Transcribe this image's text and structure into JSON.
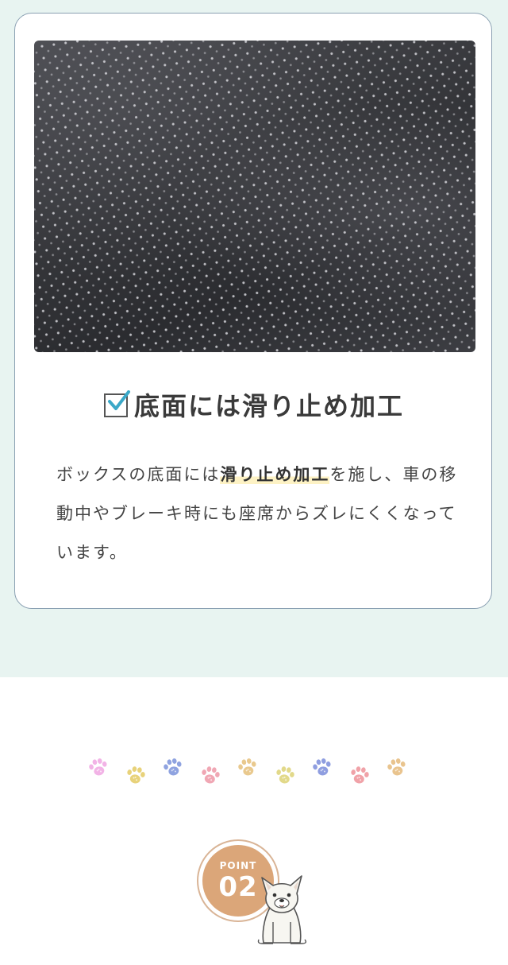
{
  "feature": {
    "heading": "底面には滑り止め加工",
    "body_before": "ボックスの底面には",
    "body_highlight": "滑り止め加工",
    "body_after": "を施し、車の移動中やブレーキ時にも座席からズレにくくなっています。"
  },
  "paws": {
    "colors": [
      "#f2b3e6",
      "#e8d27a",
      "#8fa3e0",
      "#f0a7b4",
      "#e9c98e",
      "#e2d98a",
      "#8f9ee0",
      "#f0a2a8",
      "#e9c48e"
    ]
  },
  "point": {
    "label": "POINT",
    "number": "02"
  },
  "colors": {
    "band": "#e8f4f1",
    "badge": "#dba679",
    "highlight": "#fdf2c4"
  }
}
